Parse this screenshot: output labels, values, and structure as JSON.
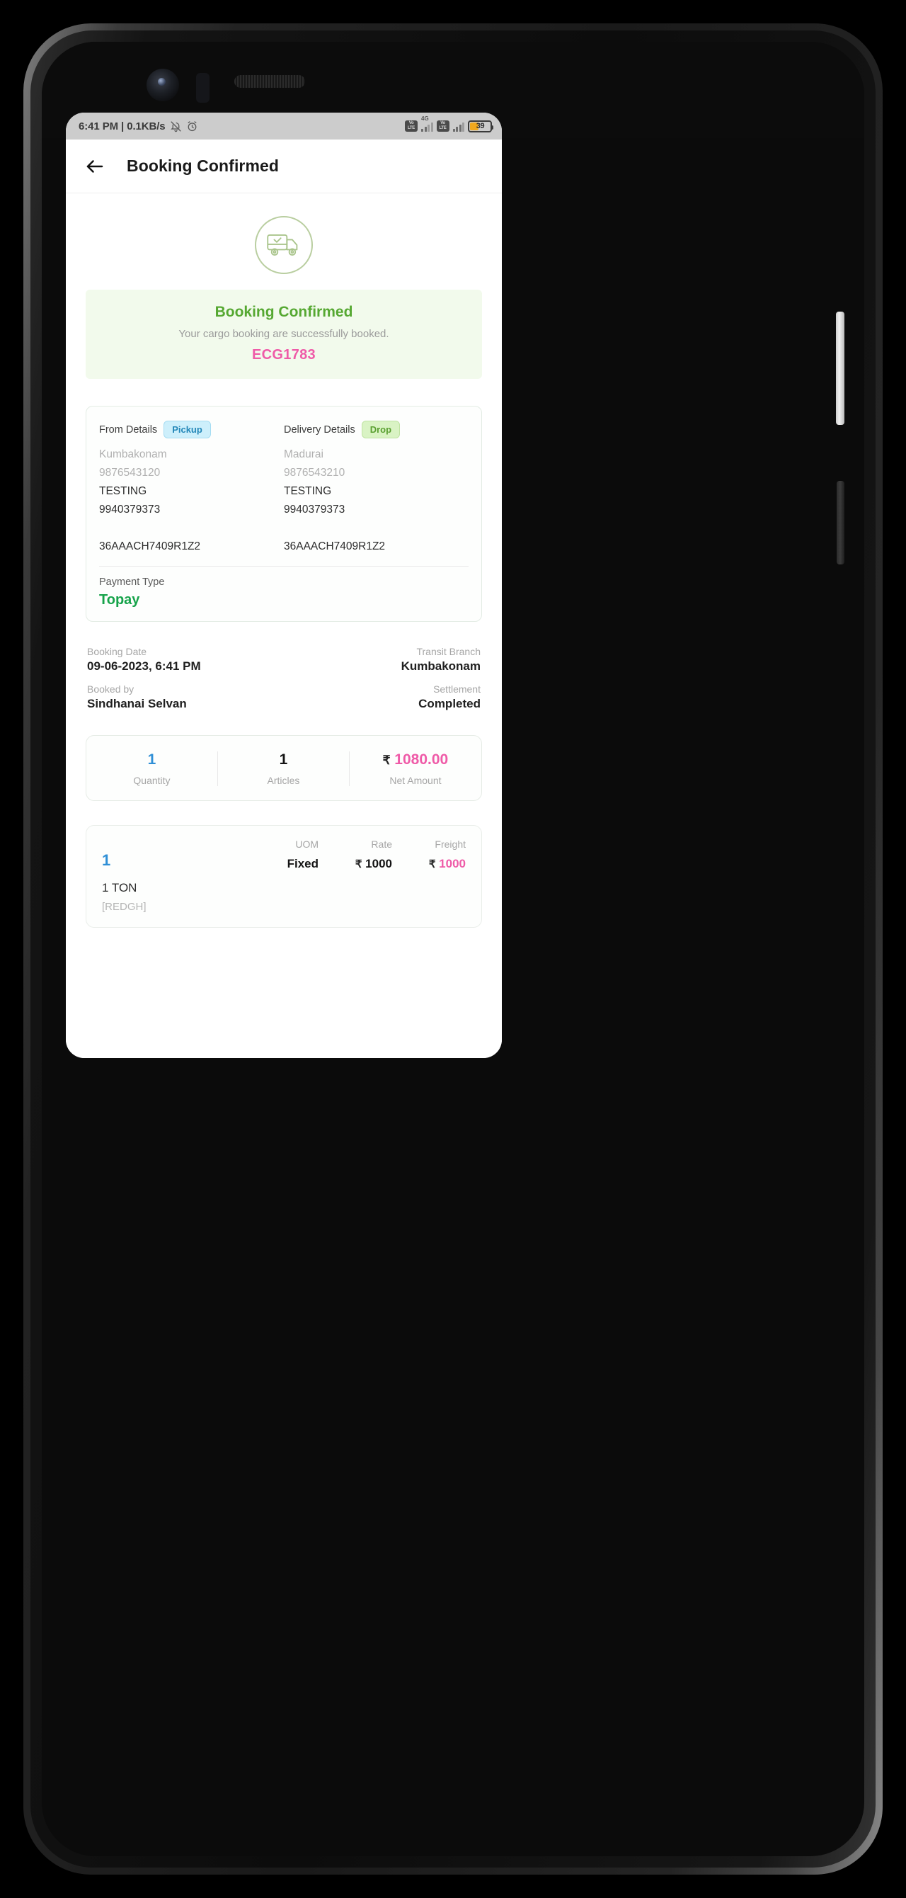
{
  "status_bar": {
    "time_and_speed": "6:41 PM | 0.1KB/s",
    "bell_icon": "bell-muted-icon",
    "alarm_icon": "alarm-clock-icon",
    "volte_label_1": "VoLTE",
    "volte_label_2": "VoLTE",
    "network_type": "4G",
    "battery_percent": "39"
  },
  "app_bar": {
    "back_icon": "back-arrow-icon",
    "title": "Booking Confirmed"
  },
  "hero": {
    "icon": "delivery-truck-check-icon"
  },
  "banner": {
    "title": "Booking Confirmed",
    "subtitle": "Your cargo booking are successfully booked.",
    "code": "ECG1783",
    "bg_color": "#f2faec",
    "title_color": "#56a832",
    "code_color": "#ef5ba8"
  },
  "details_card": {
    "from": {
      "heading": "From Details",
      "badge": "Pickup",
      "city": "Kumbakonam",
      "phone_primary": "9876543120",
      "contact_name": "TESTING",
      "contact_phone": "9940379373",
      "gstin": "36AAACH7409R1Z2"
    },
    "delivery": {
      "heading": "Delivery Details",
      "badge": "Drop",
      "city": "Madurai",
      "phone_primary": "9876543210",
      "contact_name": "TESTING",
      "contact_phone": "9940379373",
      "gstin": "36AAACH7409R1Z2"
    },
    "payment_label": "Payment Type",
    "payment_value": "Topay",
    "payment_color": "#16a34a"
  },
  "meta": {
    "booking_date_label": "Booking Date",
    "booking_date_value": "09-06-2023, 6:41 PM",
    "booked_by_label": "Booked by",
    "booked_by_value": "Sindhanai Selvan",
    "transit_branch_label": "Transit Branch",
    "transit_branch_value": "Kumbakonam",
    "settlement_label": "Settlement",
    "settlement_value": "Completed"
  },
  "summary": {
    "cells": [
      {
        "value": "1",
        "label": "Quantity",
        "color": "blue"
      },
      {
        "value": "1",
        "label": "Articles",
        "color": "black"
      },
      {
        "value": "1080.00",
        "label": "Net Amount",
        "color": "pink",
        "currency": "₹"
      }
    ]
  },
  "item": {
    "serial": "1",
    "uom_label": "UOM",
    "uom_value": "Fixed",
    "rate_label": "Rate",
    "rate_value": "1000",
    "rate_currency": "₹",
    "freight_label": "Freight",
    "freight_value": "1000",
    "freight_currency": "₹",
    "description": "1 TON",
    "code": "[REDGH]"
  }
}
